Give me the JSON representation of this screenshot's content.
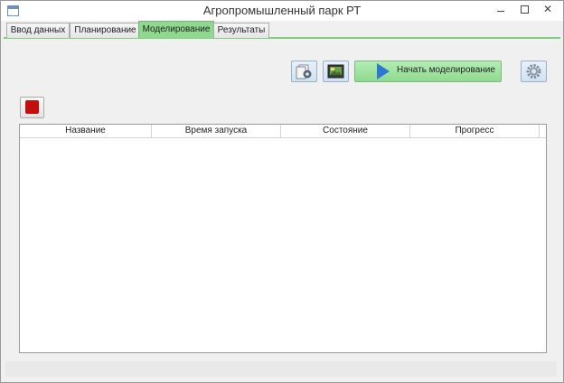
{
  "window": {
    "title": "Агропромышленный парк РТ",
    "minimize_icon": "minimize-icon",
    "maximize_icon": "maximize-icon",
    "close_icon": "close-icon",
    "close_glyph": "✕"
  },
  "tabs": [
    {
      "label": "Ввод данных",
      "active": false
    },
    {
      "label": "Планирование",
      "active": false
    },
    {
      "label": "Моделирование",
      "active": true
    },
    {
      "label": "Результаты",
      "active": false
    }
  ],
  "toolbar": {
    "run_label": "Начать моделирование",
    "icons": [
      "gear-document-icon",
      "image-icon",
      "play-icon",
      "settings-icon",
      "stop-icon"
    ]
  },
  "table": {
    "columns": [
      "Название",
      "Время запуска",
      "Состояние",
      "Прогресс"
    ],
    "rows": []
  },
  "colors": {
    "active_tab": "#8fd88f",
    "run_button": "#9ee29e",
    "play": "#2d78d2",
    "stop": "#c40f0f",
    "tool_button": "#d8e8f6"
  }
}
